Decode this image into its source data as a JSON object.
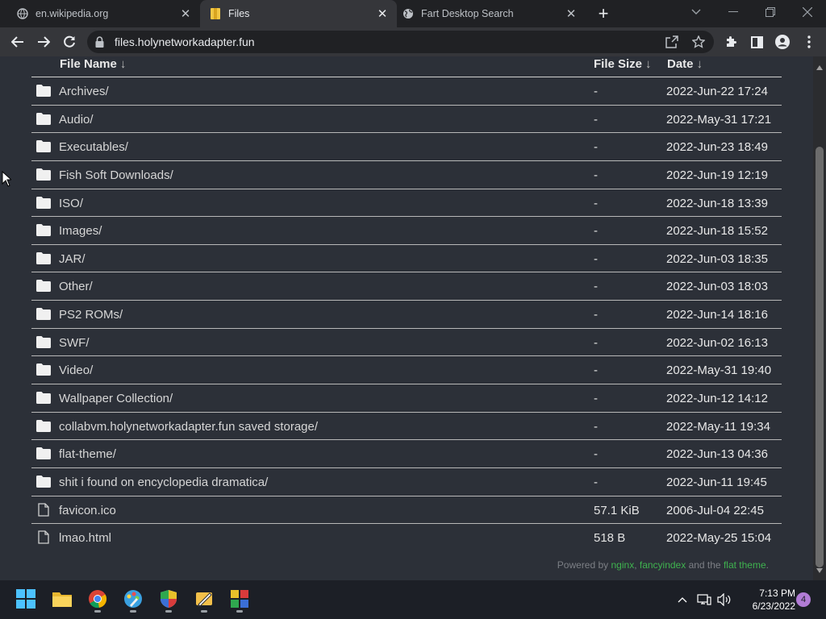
{
  "browser": {
    "tabs": [
      {
        "title": "en.wikipedia.org",
        "favicon": "wikipedia-icon",
        "active": false
      },
      {
        "title": "Files",
        "favicon": "folder-icon",
        "active": true
      },
      {
        "title": "Fart Desktop Search",
        "favicon": "globe-icon",
        "active": false
      }
    ],
    "address": "files.holynetworkadapter.fun"
  },
  "listing": {
    "columns": {
      "name": "File Name",
      "size": "File Size",
      "date": "Date",
      "sort_arrow": "↓"
    },
    "rows": [
      {
        "name": "Archives/",
        "size": "-",
        "date": "2022-Jun-22 17:24",
        "type": "folder"
      },
      {
        "name": "Audio/",
        "size": "-",
        "date": "2022-May-31 17:21",
        "type": "folder"
      },
      {
        "name": "Executables/",
        "size": "-",
        "date": "2022-Jun-23 18:49",
        "type": "folder"
      },
      {
        "name": "Fish Soft Downloads/",
        "size": "-",
        "date": "2022-Jun-19 12:19",
        "type": "folder"
      },
      {
        "name": "ISO/",
        "size": "-",
        "date": "2022-Jun-18 13:39",
        "type": "folder"
      },
      {
        "name": "Images/",
        "size": "-",
        "date": "2022-Jun-18 15:52",
        "type": "folder"
      },
      {
        "name": "JAR/",
        "size": "-",
        "date": "2022-Jun-03 18:35",
        "type": "folder"
      },
      {
        "name": "Other/",
        "size": "-",
        "date": "2022-Jun-03 18:03",
        "type": "folder"
      },
      {
        "name": "PS2 ROMs/",
        "size": "-",
        "date": "2022-Jun-14 18:16",
        "type": "folder"
      },
      {
        "name": "SWF/",
        "size": "-",
        "date": "2022-Jun-02 16:13",
        "type": "folder"
      },
      {
        "name": "Video/",
        "size": "-",
        "date": "2022-May-31 19:40",
        "type": "folder"
      },
      {
        "name": "Wallpaper Collection/",
        "size": "-",
        "date": "2022-Jun-12 14:12",
        "type": "folder"
      },
      {
        "name": "collabvm.holynetworkadapter.fun saved storage/",
        "size": "-",
        "date": "2022-May-11 19:34",
        "type": "folder"
      },
      {
        "name": "flat-theme/",
        "size": "-",
        "date": "2022-Jun-13 04:36",
        "type": "folder"
      },
      {
        "name": "shit i found on encyclopedia dramatica/",
        "size": "-",
        "date": "2022-Jun-11 19:45",
        "type": "folder"
      },
      {
        "name": "favicon.ico",
        "size": "57.1 KiB",
        "date": "2006-Jul-04 22:45",
        "type": "file"
      },
      {
        "name": "lmao.html",
        "size": "518 B",
        "date": "2022-May-25 15:04",
        "type": "file"
      }
    ]
  },
  "footer": {
    "prefix": "Powered by ",
    "link1": "nginx",
    "sep": ", ",
    "link2": "fancyindex",
    "mid": " and the ",
    "link3": "flat theme",
    "suffix": "."
  },
  "taskbar": {
    "apps": [
      "start-icon",
      "file-explorer-icon",
      "chrome-icon",
      "paint-icon",
      "security-shield-icon",
      "pencil-app-icon",
      "office-app-icon"
    ],
    "time": "7:13 PM",
    "date": "6/23/2022",
    "notification_count": "4"
  },
  "colors": {
    "page_bg": "#2c3038",
    "link_green": "#3fb34f",
    "tab_strip": "#202124",
    "toolbar": "#35363a"
  }
}
